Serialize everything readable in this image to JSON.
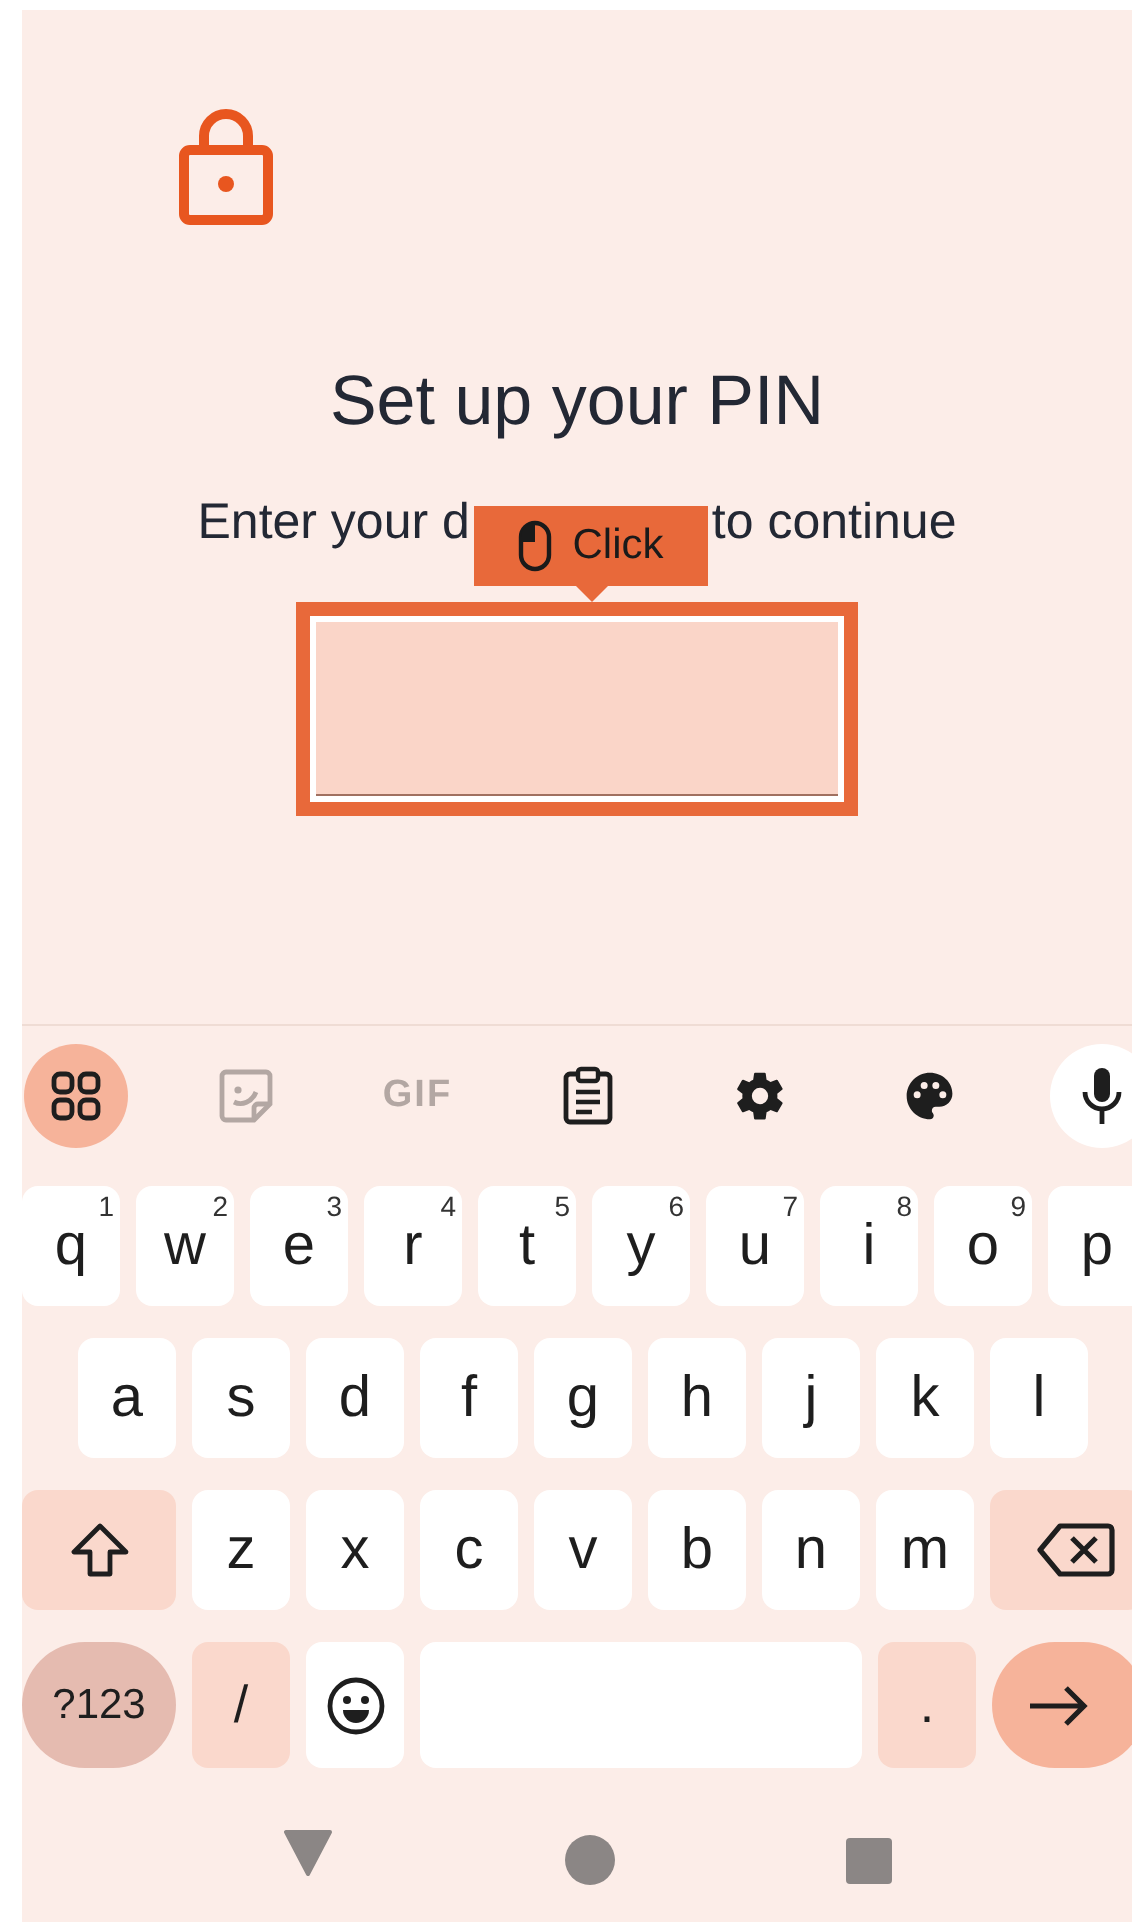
{
  "screen": {
    "title": "Set up your PIN",
    "subtitle_parts": [
      "Enter your d",
      "to continue"
    ]
  },
  "annotation": {
    "label": "Click",
    "target_highlighted": true
  },
  "keyboard": {
    "toolbar": [
      {
        "kind": "apps",
        "selected": true,
        "disabled": false
      },
      {
        "kind": "sticker",
        "selected": false,
        "disabled": true
      },
      {
        "kind": "gif",
        "label": "GIF",
        "selected": false,
        "disabled": true
      },
      {
        "kind": "clipboard",
        "selected": false,
        "disabled": false
      },
      {
        "kind": "settings",
        "selected": false,
        "disabled": false
      },
      {
        "kind": "palette",
        "selected": false,
        "disabled": false
      },
      {
        "kind": "mic",
        "selected": false,
        "disabled": false
      }
    ],
    "rows": [
      {
        "keys": [
          {
            "kind": "letter",
            "label": "q",
            "hint": "1"
          },
          {
            "kind": "letter",
            "label": "w",
            "hint": "2"
          },
          {
            "kind": "letter",
            "label": "e",
            "hint": "3"
          },
          {
            "kind": "letter",
            "label": "r",
            "hint": "4"
          },
          {
            "kind": "letter",
            "label": "t",
            "hint": "5"
          },
          {
            "kind": "letter",
            "label": "y",
            "hint": "6"
          },
          {
            "kind": "letter",
            "label": "u",
            "hint": "7"
          },
          {
            "kind": "letter",
            "label": "i",
            "hint": "8"
          },
          {
            "kind": "letter",
            "label": "o",
            "hint": "9"
          },
          {
            "kind": "letter",
            "label": "p"
          }
        ]
      },
      {
        "keys": [
          {
            "kind": "letter",
            "label": "a"
          },
          {
            "kind": "letter",
            "label": "s"
          },
          {
            "kind": "letter",
            "label": "d"
          },
          {
            "kind": "letter",
            "label": "f"
          },
          {
            "kind": "letter",
            "label": "g"
          },
          {
            "kind": "letter",
            "label": "h"
          },
          {
            "kind": "letter",
            "label": "j"
          },
          {
            "kind": "letter",
            "label": "k"
          },
          {
            "kind": "letter",
            "label": "l"
          }
        ]
      },
      {
        "keys": [
          {
            "kind": "shift"
          },
          {
            "kind": "letter",
            "label": "z"
          },
          {
            "kind": "letter",
            "label": "x"
          },
          {
            "kind": "letter",
            "label": "c"
          },
          {
            "kind": "letter",
            "label": "v"
          },
          {
            "kind": "letter",
            "label": "b"
          },
          {
            "kind": "letter",
            "label": "n"
          },
          {
            "kind": "letter",
            "label": "m"
          },
          {
            "kind": "backspace"
          }
        ]
      },
      {
        "keys": [
          {
            "kind": "symbols",
            "label": "?123"
          },
          {
            "kind": "punct",
            "label": "/"
          },
          {
            "kind": "emoji"
          },
          {
            "kind": "space"
          },
          {
            "kind": "punct",
            "label": "."
          },
          {
            "kind": "enter"
          }
        ]
      }
    ]
  }
}
